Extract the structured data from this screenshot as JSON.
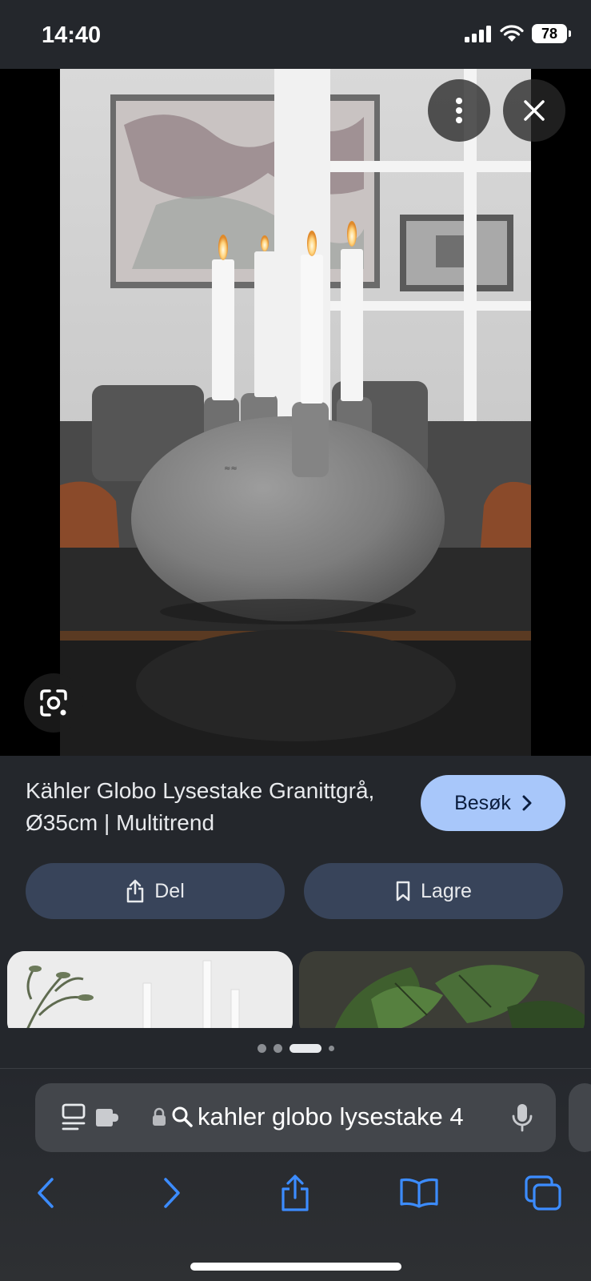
{
  "status": {
    "time": "14:40",
    "battery": "78"
  },
  "viewer": {
    "more_icon": "more-vertical-icon",
    "close_icon": "close-icon",
    "lens_icon": "google-lens-icon"
  },
  "result": {
    "title": "Kähler Globo Lysestake Granittgrå, Ø35cm | Multitrend",
    "visit_label": "Besøk",
    "share_label": "Del",
    "save_label": "Lagre"
  },
  "pagination": {
    "count": 4,
    "active_index": 2
  },
  "browser": {
    "url_text": "kahler globo lysestake 4",
    "toolbar": [
      "back-icon",
      "forward-icon",
      "share-icon",
      "bookmarks-icon",
      "tabs-icon"
    ]
  },
  "colors": {
    "accent": "#a8c7fa",
    "safari_blue": "#3c8cff",
    "chip_bg": "#38445a"
  }
}
